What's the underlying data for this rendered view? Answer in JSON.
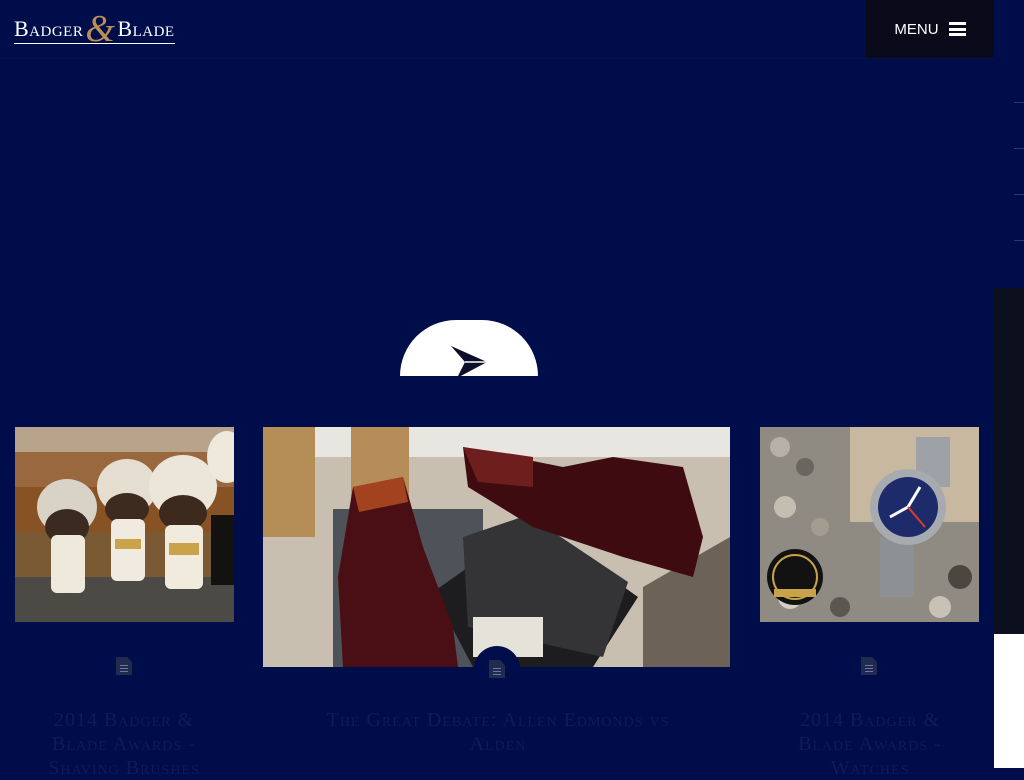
{
  "header": {
    "logo": {
      "left": "Badger",
      "amp": "&",
      "right": "Blade"
    },
    "menu_label": "MENU"
  },
  "icons": {
    "hamburger": "hamburger-menu-icon",
    "slider_arrow": "paper-plane-arrow-icon",
    "post_type": "document-icon"
  },
  "posts": [
    {
      "title": "2014 Badger & Blade Awards - Shaving Brushes",
      "image": "shaving brushes on rock"
    },
    {
      "title": "The Great Debate: Allen Edmonds vs Alden",
      "image": "burgundy chukka boots on shoe box"
    },
    {
      "title": "2014 Badger & Blade Awards - Watches",
      "image": "blue dial dive watch on pebbles"
    }
  ],
  "colors": {
    "background": "#000d4b",
    "menu_bg": "#0a0a1a",
    "accent_gold": "#b98f56",
    "title_text": "#101b59"
  }
}
